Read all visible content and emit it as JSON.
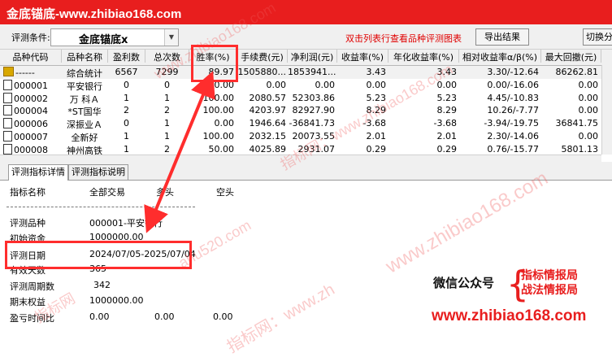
{
  "window": {
    "title": "金底锚底-www.zhibiao168.com"
  },
  "toolbar": {
    "label": "评测条件:",
    "condition": "金底锚底x",
    "hint": "双击列表行查看品种评测图表",
    "export_label": "导出结果",
    "switch_label": "切换分"
  },
  "grid": {
    "columns": [
      "品种代码",
      "品种名称",
      "盈利数",
      "总次数",
      "胜率(%)",
      "手续费(元)",
      "净利润(元)",
      "收益率(%)",
      "年化收益率(%)",
      "相对收益率α/β(%)",
      "最大回撤(元)"
    ],
    "rows": [
      {
        "code": "------",
        "name": "综合统计",
        "wins": "6567",
        "total": "7299",
        "rate": "89.97",
        "fee": "1505880...",
        "profit": "1853941...",
        "ret": "3.43",
        "annual": "3.43",
        "ab": "3.30/-12.64",
        "dd": "86262.81",
        "icon": "summary-icon"
      },
      {
        "code": "000001",
        "name": "平安银行",
        "wins": "0",
        "total": "0",
        "rate": "0.00",
        "fee": "0.00",
        "profit": "0.00",
        "ret": "0.00",
        "annual": "0.00",
        "ab": "0.00/-16.06",
        "dd": "0.00",
        "icon": "file-icon"
      },
      {
        "code": "000002",
        "name": "万 科Ａ",
        "wins": "1",
        "total": "1",
        "rate": "100.00",
        "fee": "2080.57",
        "profit": "52303.86",
        "ret": "5.23",
        "annual": "5.23",
        "ab": "4.45/-10.83",
        "dd": "0.00",
        "icon": "file-icon"
      },
      {
        "code": "000004",
        "name": "*ST国华",
        "wins": "2",
        "total": "2",
        "rate": "100.00",
        "fee": "4203.97",
        "profit": "82927.90",
        "ret": "8.29",
        "annual": "8.29",
        "ab": "10.26/-7.77",
        "dd": "0.00",
        "icon": "file-icon"
      },
      {
        "code": "000006",
        "name": "深振业Ａ",
        "wins": "0",
        "total": "1",
        "rate": "0.00",
        "fee": "1946.64",
        "profit": "-36841.73",
        "ret": "-3.68",
        "annual": "-3.68",
        "ab": "-3.94/-19.75",
        "dd": "36841.75",
        "icon": "file-icon"
      },
      {
        "code": "000007",
        "name": "全新好",
        "wins": "1",
        "total": "1",
        "rate": "100.00",
        "fee": "2032.15",
        "profit": "20073.55",
        "ret": "2.01",
        "annual": "2.01",
        "ab": "2.30/-14.06",
        "dd": "0.00",
        "icon": "file-icon"
      },
      {
        "code": "000008",
        "name": "神州高铁",
        "wins": "1",
        "total": "2",
        "rate": "50.00",
        "fee": "4025.89",
        "profit": "2931.07",
        "ret": "0.29",
        "annual": "0.29",
        "ab": "0.76/-15.77",
        "dd": "5801.13",
        "icon": "file-icon"
      }
    ]
  },
  "tabs": [
    "评测指标详情",
    "评测指标说明"
  ],
  "detail": {
    "headers": [
      "指标名称",
      "全部交易",
      "多头",
      "空头"
    ],
    "rows": [
      {
        "label": "评测品种",
        "value": "000001-平安银行"
      },
      {
        "label": "初始资金",
        "value": "1000000.00"
      },
      {
        "label": "评测日期",
        "value": "2024/07/05-2025/07/04"
      },
      {
        "label": "有效天数",
        "value": "365"
      },
      {
        "label": "评测周期数",
        "value": "342"
      },
      {
        "label": "期末权益",
        "value": "1000000.00"
      },
      {
        "label": "盈亏时间比",
        "value": "0.00",
        "v2": "0.00",
        "v3": "0.00"
      }
    ]
  },
  "watermark": {
    "text": "指标网：www.zhibiao168.com",
    "corner_label": "微信公众号",
    "corner_lines": [
      "指标情报局",
      "战法情报局"
    ],
    "corner_url": "www.zhibiao168.com",
    "faint": [
      "www.zhibiao168.com",
      "指标网：www.zhibiao168.com",
      "ahu520.com",
      "指标网",
      "www.zhibiao168.com",
      "指标网：www.zh"
    ]
  },
  "colors": {
    "title_bg": "#e81e1e",
    "highlight": "#ff2d2d",
    "hint": "#e00000"
  }
}
